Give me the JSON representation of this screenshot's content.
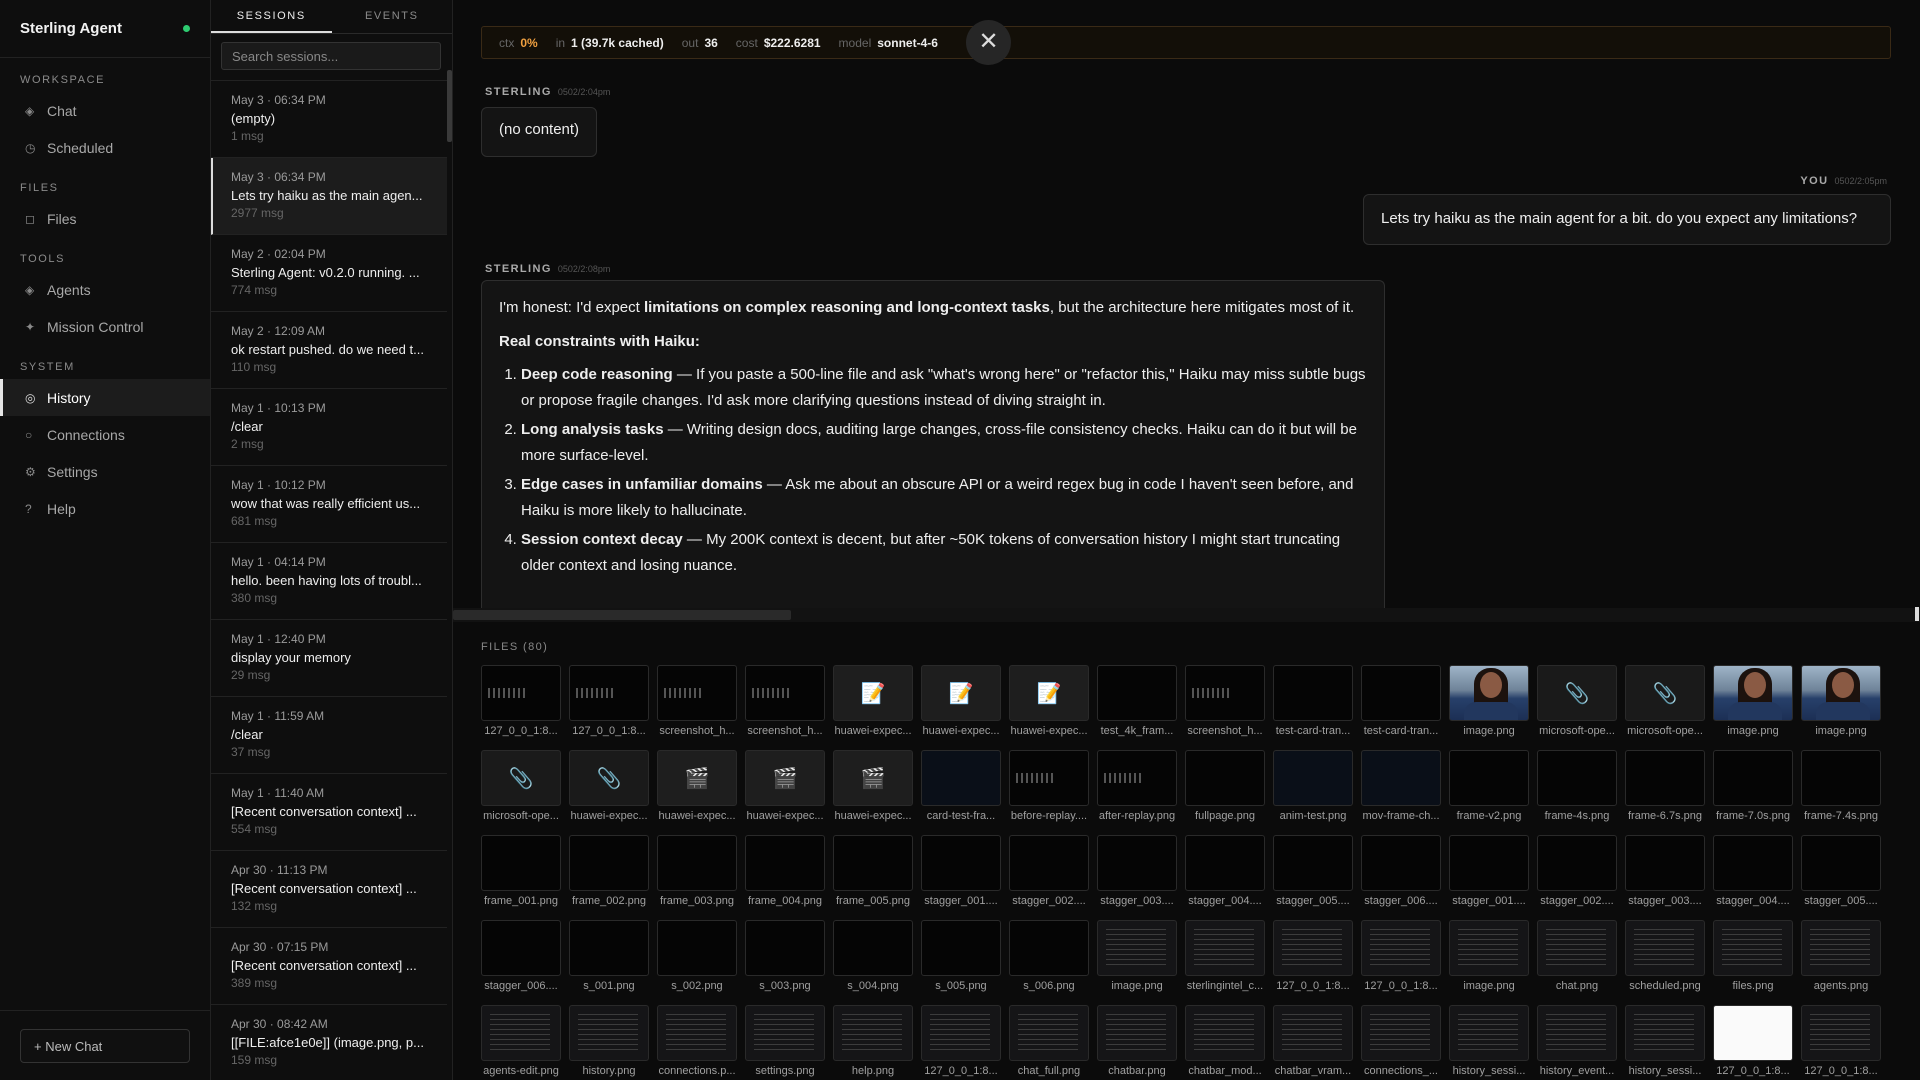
{
  "brand": {
    "name": "Sterling Agent"
  },
  "nav": {
    "sections": [
      {
        "title": "WORKSPACE",
        "items": [
          {
            "label": "Chat",
            "icon": "chat-icon"
          },
          {
            "label": "Scheduled",
            "icon": "clock-icon"
          }
        ]
      },
      {
        "title": "FILES",
        "items": [
          {
            "label": "Files",
            "icon": "file-icon"
          }
        ]
      },
      {
        "title": "TOOLS",
        "items": [
          {
            "label": "Agents",
            "icon": "agents-icon"
          },
          {
            "label": "Mission Control",
            "icon": "mission-icon"
          }
        ]
      },
      {
        "title": "SYSTEM",
        "items": [
          {
            "label": "History",
            "icon": "history-icon",
            "active": true
          },
          {
            "label": "Connections",
            "icon": "connections-icon"
          },
          {
            "label": "Settings",
            "icon": "settings-icon"
          },
          {
            "label": "Help",
            "icon": "help-icon"
          }
        ]
      }
    ],
    "new_chat": "+ New Chat"
  },
  "sessions_panel": {
    "tabs": [
      "SESSIONS",
      "EVENTS"
    ],
    "search_placeholder": "Search sessions...",
    "items": [
      {
        "date": "May 3 · 06:34 PM",
        "title": "(empty)",
        "count": "1 msg"
      },
      {
        "date": "May 3 · 06:34 PM",
        "title": "Lets try haiku as the main agen...",
        "count": "2977 msg",
        "active": true
      },
      {
        "date": "May 2 · 02:04 PM",
        "title": "Sterling Agent: v0.2.0 running. ...",
        "count": "774 msg"
      },
      {
        "date": "May 2 · 12:09 AM",
        "title": "ok restart pushed. do we need t...",
        "count": "110 msg"
      },
      {
        "date": "May 1 · 10:13 PM",
        "title": "/clear",
        "count": "2 msg"
      },
      {
        "date": "May 1 · 10:12 PM",
        "title": "wow that was really efficient us...",
        "count": "681 msg"
      },
      {
        "date": "May 1 · 04:14 PM",
        "title": "hello. been having lots of troubl...",
        "count": "380 msg"
      },
      {
        "date": "May 1 · 12:40 PM",
        "title": "display your memory",
        "count": "29 msg"
      },
      {
        "date": "May 1 · 11:59 AM",
        "title": "/clear",
        "count": "37 msg"
      },
      {
        "date": "May 1 · 11:40 AM",
        "title": "[Recent conversation context] ...",
        "count": "554 msg"
      },
      {
        "date": "Apr 30 · 11:13 PM",
        "title": "[Recent conversation context] ...",
        "count": "132 msg"
      },
      {
        "date": "Apr 30 · 07:15 PM",
        "title": "[Recent conversation context] ...",
        "count": "389 msg"
      },
      {
        "date": "Apr 30 · 08:42 AM",
        "title": "[[FILE:afce1e0e]] (image.png, p...",
        "count": "159 msg"
      }
    ]
  },
  "context_bar": {
    "ctx_label": "ctx",
    "ctx_value": "0%",
    "in_label": "in",
    "in_value": "1 (39.7k cached)",
    "out_label": "out",
    "out_value": "36",
    "cost_label": "cost",
    "cost_value": "$222.6281",
    "model_label": "model",
    "model_value": "sonnet-4-6"
  },
  "messages": {
    "m1": {
      "sender": "STERLING",
      "time": "0502/2:04pm",
      "text": "(no content)"
    },
    "m2": {
      "sender": "YOU",
      "time": "0502/2:05pm",
      "text": "Lets try haiku as the main agent for a bit. do you expect any limitations?"
    },
    "m3": {
      "sender": "STERLING",
      "time": "0502/2:08pm",
      "intro_a": "I'm honest: I'd expect ",
      "intro_b": "limitations on complex reasoning and long-context tasks",
      "intro_c": ", but the architecture here mitigates most of it.",
      "heading": "Real constraints with Haiku:",
      "items": [
        {
          "title": "Deep code reasoning",
          "text": " — If you paste a 500-line file and ask \"what's wrong here\" or \"refactor this,\" Haiku may miss subtle bugs or propose fragile changes. I'd ask more clarifying questions instead of diving straight in."
        },
        {
          "title": "Long analysis tasks",
          "text": " — Writing design docs, auditing large changes, cross-file consistency checks. Haiku can do it but will be more surface-level."
        },
        {
          "title": "Edge cases in unfamiliar domains",
          "text": " — Ask me about an obscure API or a weird regex bug in code I haven't seen before, and Haiku is more likely to hallucinate."
        },
        {
          "title": "Session context decay",
          "text": " — My 200K context is decent, but after ~50K tokens of conversation history I might start truncating older context and losing nuance."
        }
      ]
    }
  },
  "files": {
    "label": "FILES (80)",
    "items": [
      {
        "name": "127_0_0_1:8...",
        "kind": "screen"
      },
      {
        "name": "127_0_0_1:8...",
        "kind": "screen"
      },
      {
        "name": "screenshot_h...",
        "kind": "screen"
      },
      {
        "name": "screenshot_h...",
        "kind": "screen"
      },
      {
        "name": "huawei-expec...",
        "kind": "doc"
      },
      {
        "name": "huawei-expec...",
        "kind": "doc"
      },
      {
        "name": "huawei-expec...",
        "kind": "doc"
      },
      {
        "name": "test_4k_fram...",
        "kind": "dark"
      },
      {
        "name": "screenshot_h...",
        "kind": "screen"
      },
      {
        "name": "test-card-tran...",
        "kind": "dark"
      },
      {
        "name": "test-card-tran...",
        "kind": "dark"
      },
      {
        "name": "image.png",
        "kind": "photo"
      },
      {
        "name": "microsoft-ope...",
        "kind": "clip"
      },
      {
        "name": "microsoft-ope...",
        "kind": "clip"
      },
      {
        "name": "image.png",
        "kind": "photo"
      },
      {
        "name": "image.png",
        "kind": "photo"
      },
      {
        "name": "microsoft-ope...",
        "kind": "clip"
      },
      {
        "name": "huawei-expec...",
        "kind": "clip"
      },
      {
        "name": "huawei-expec...",
        "kind": "vid"
      },
      {
        "name": "huawei-expec...",
        "kind": "vid"
      },
      {
        "name": "huawei-expec...",
        "kind": "vid"
      },
      {
        "name": "card-test-fra...",
        "kind": "dark2"
      },
      {
        "name": "before-replay....",
        "kind": "screen"
      },
      {
        "name": "after-replay.png",
        "kind": "screen"
      },
      {
        "name": "fullpage.png",
        "kind": "dark"
      },
      {
        "name": "anim-test.png",
        "kind": "dark2"
      },
      {
        "name": "mov-frame-ch...",
        "kind": "dark2"
      },
      {
        "name": "frame-v2.png",
        "kind": "dark"
      },
      {
        "name": "frame-4s.png",
        "kind": "dark"
      },
      {
        "name": "frame-6.7s.png",
        "kind": "dark"
      },
      {
        "name": "frame-7.0s.png",
        "kind": "dark"
      },
      {
        "name": "frame-7.4s.png",
        "kind": "dark"
      },
      {
        "name": "frame_001.png",
        "kind": "dark"
      },
      {
        "name": "frame_002.png",
        "kind": "dark"
      },
      {
        "name": "frame_003.png",
        "kind": "dark"
      },
      {
        "name": "frame_004.png",
        "kind": "dark"
      },
      {
        "name": "frame_005.png",
        "kind": "dark"
      },
      {
        "name": "stagger_001....",
        "kind": "dark"
      },
      {
        "name": "stagger_002....",
        "kind": "dark"
      },
      {
        "name": "stagger_003....",
        "kind": "dark"
      },
      {
        "name": "stagger_004....",
        "kind": "dark"
      },
      {
        "name": "stagger_005....",
        "kind": "dark"
      },
      {
        "name": "stagger_006....",
        "kind": "dark"
      },
      {
        "name": "stagger_001....",
        "kind": "dark"
      },
      {
        "name": "stagger_002....",
        "kind": "dark"
      },
      {
        "name": "stagger_003....",
        "kind": "dark"
      },
      {
        "name": "stagger_004....",
        "kind": "dark"
      },
      {
        "name": "stagger_005....",
        "kind": "dark"
      },
      {
        "name": "stagger_006....",
        "kind": "dark"
      },
      {
        "name": "s_001.png",
        "kind": "dark"
      },
      {
        "name": "s_002.png",
        "kind": "dark"
      },
      {
        "name": "s_003.png",
        "kind": "dark"
      },
      {
        "name": "s_004.png",
        "kind": "dark"
      },
      {
        "name": "s_005.png",
        "kind": "dark"
      },
      {
        "name": "s_006.png",
        "kind": "dark"
      },
      {
        "name": "image.png",
        "kind": "ui"
      },
      {
        "name": "sterlingintel_c...",
        "kind": "ui"
      },
      {
        "name": "127_0_0_1:8...",
        "kind": "ui"
      },
      {
        "name": "127_0_0_1:8...",
        "kind": "ui"
      },
      {
        "name": "image.png",
        "kind": "ui"
      },
      {
        "name": "chat.png",
        "kind": "ui"
      },
      {
        "name": "scheduled.png",
        "kind": "ui"
      },
      {
        "name": "files.png",
        "kind": "ui"
      },
      {
        "name": "agents.png",
        "kind": "ui"
      },
      {
        "name": "agents-edit.png",
        "kind": "ui"
      },
      {
        "name": "history.png",
        "kind": "ui"
      },
      {
        "name": "connections.p...",
        "kind": "ui"
      },
      {
        "name": "settings.png",
        "kind": "ui"
      },
      {
        "name": "help.png",
        "kind": "ui"
      },
      {
        "name": "127_0_0_1:8...",
        "kind": "ui"
      },
      {
        "name": "chat_full.png",
        "kind": "ui"
      },
      {
        "name": "chatbar.png",
        "kind": "ui"
      },
      {
        "name": "chatbar_mod...",
        "kind": "ui"
      },
      {
        "name": "chatbar_vram...",
        "kind": "ui"
      },
      {
        "name": "connections_...",
        "kind": "ui"
      },
      {
        "name": "history_sessi...",
        "kind": "ui"
      },
      {
        "name": "history_event...",
        "kind": "ui"
      },
      {
        "name": "history_sessi...",
        "kind": "ui"
      },
      {
        "name": "127_0_0_1:8...",
        "kind": "white"
      },
      {
        "name": "127_0_0_1:8...",
        "kind": "ui"
      }
    ]
  },
  "colors": {
    "accent_orange": "#f0a040",
    "status_green": "#2ecc71"
  }
}
